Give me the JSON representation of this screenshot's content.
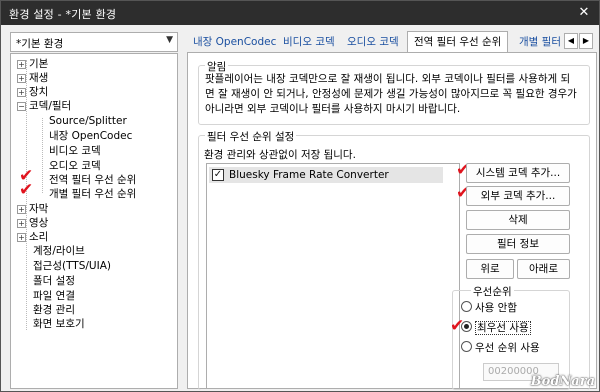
{
  "window": {
    "title": "환경 설정 - *기본 환경",
    "close": "✕"
  },
  "profile": {
    "selected": "*기본 환경",
    "arrow": "▼"
  },
  "tree": {
    "items": [
      {
        "label": "기본",
        "toggle": "+"
      },
      {
        "label": "재생",
        "toggle": "+"
      },
      {
        "label": "장치",
        "toggle": "+"
      },
      {
        "label": "코덱/필터",
        "toggle": "−"
      },
      {
        "label": "Source/Splitter"
      },
      {
        "label": "내장 OpenCodec"
      },
      {
        "label": "비디오 코덱"
      },
      {
        "label": "오디오 코덱"
      },
      {
        "label": "전역 필터 우선 순위"
      },
      {
        "label": "개별 필터 우선 순위"
      },
      {
        "label": "자막",
        "toggle": "+"
      },
      {
        "label": "영상",
        "toggle": "+"
      },
      {
        "label": "소리",
        "toggle": "+"
      },
      {
        "label": "계정/라이브"
      },
      {
        "label": "접근성(TTS/UIA)"
      },
      {
        "label": "폴더 설정"
      },
      {
        "label": "파일 연결"
      },
      {
        "label": "환경 관리"
      },
      {
        "label": "화면 보호기"
      }
    ]
  },
  "tabs": [
    {
      "label": "내장 OpenCodec"
    },
    {
      "label": "비디오 코덱"
    },
    {
      "label": "오디오 코덱"
    },
    {
      "label": "전역 필터 우선 순위"
    },
    {
      "label": "개별 필터"
    }
  ],
  "tab_scroll": {
    "left": "◀",
    "right": "▶"
  },
  "notice": {
    "label": "알림",
    "lines": [
      "팟플레이어는 내장 코덱만으로 잘 재생이 됩니다. 외부 코덱이나 필터를 사용하게 되",
      "면 잘 재생이 안 되거나, 안정성에 문제가 생길 가능성이 많아지므로 꼭 필요한 경우가",
      "아니라면 외부 코덱이나 필터를 사용하지 마시기 바랍니다."
    ]
  },
  "filter_settings": {
    "label": "필터 우선 순위 설정",
    "description": "환경 관리와 상관없이 저장 됩니다.",
    "list": [
      {
        "name": "Bluesky Frame Rate Converter",
        "checked": true
      }
    ],
    "check_glyph": "✓",
    "buttons": {
      "add_system": "시스템 코덱 추가...",
      "add_external": "외부 코덱 추가...",
      "delete": "삭제",
      "info": "필터 정보",
      "up": "위로",
      "down": "아래로"
    }
  },
  "priority": {
    "label": "우선순위",
    "options": [
      {
        "label": "사용 안함",
        "selected": false
      },
      {
        "label": "최우선 사용",
        "selected": true
      },
      {
        "label": "우선 순위 사용",
        "selected": false
      }
    ],
    "value_placeholder": "00200000"
  },
  "annotations": {
    "check": "✔",
    "color": "#e0141e"
  },
  "watermark": "BodNara"
}
